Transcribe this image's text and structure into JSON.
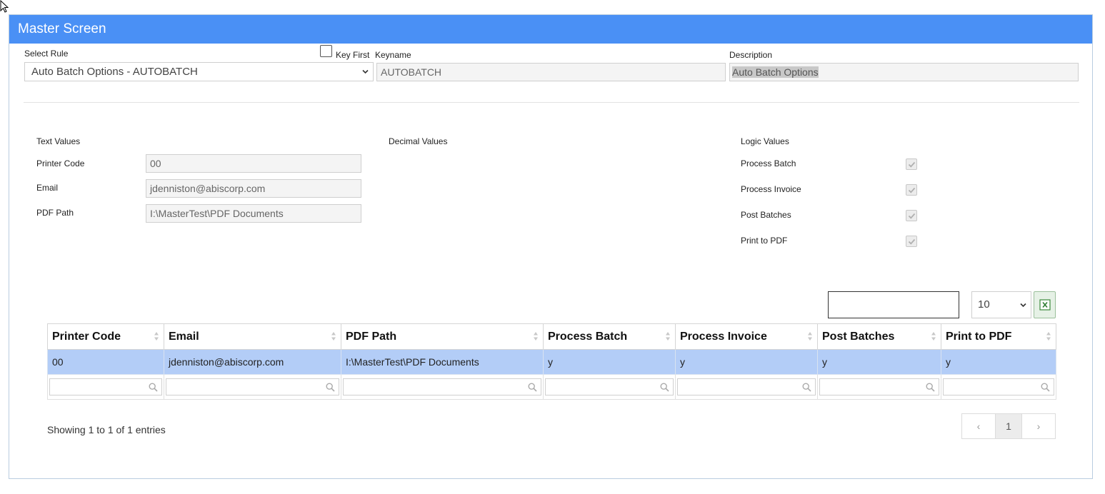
{
  "header": {
    "title": "Master Screen"
  },
  "form": {
    "select_rule_label": "Select Rule",
    "select_rule_value": "Auto Batch Options - AUTOBATCH",
    "key_first_label": "Key First",
    "keyname_label": "Keyname",
    "keyname_value": "AUTOBATCH",
    "description_label": "Description",
    "description_value": "Auto Batch Options"
  },
  "text_values": {
    "section_label": "Text Values",
    "fields": [
      {
        "label": "Printer Code",
        "value": "00"
      },
      {
        "label": "Email",
        "value": "jdenniston@abiscorp.com"
      },
      {
        "label": "PDF Path",
        "value": "I:\\MasterTest\\PDF Documents"
      }
    ]
  },
  "decimal_values": {
    "section_label": "Decimal Values"
  },
  "logic_values": {
    "section_label": "Logic Values",
    "fields": [
      {
        "label": "Process Batch",
        "checked": true
      },
      {
        "label": "Process Invoice",
        "checked": true
      },
      {
        "label": "Post Batches",
        "checked": true
      },
      {
        "label": "Print to PDF",
        "checked": true
      }
    ]
  },
  "table": {
    "page_length": "10",
    "columns": [
      "Printer Code",
      "Email",
      "PDF Path",
      "Process Batch",
      "Process Invoice",
      "Post Batches",
      "Print to PDF"
    ],
    "rows": [
      [
        "00",
        "jdenniston@abiscorp.com",
        "I:\\MasterTest\\PDF Documents",
        "y",
        "y",
        "y",
        "y"
      ]
    ],
    "info": "Showing 1 to 1 of 1 entries",
    "pagination": {
      "prev": "‹",
      "current": "1",
      "next": "›"
    }
  },
  "icons": {
    "cursor": "cursor-arrow-icon",
    "excel": "excel-icon",
    "search": "magnifier-icon",
    "dropdown": "chevron-down-icon",
    "sort": "sort-icon"
  },
  "colors": {
    "header_bg": "#4a90f5",
    "selected_row": "#b3cdf7"
  }
}
